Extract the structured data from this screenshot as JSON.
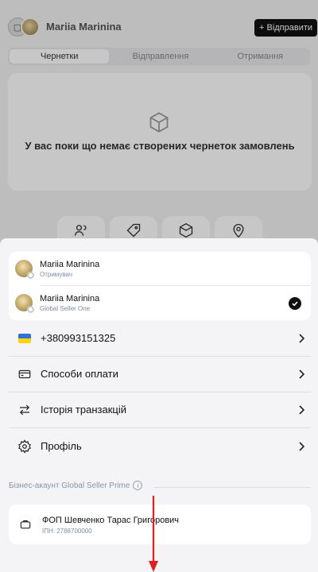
{
  "background": {
    "user_name": "Mariia Marinina",
    "send_button": "+ Відправити",
    "tabs": [
      "Чернетки",
      "Відправлення",
      "Отримання"
    ],
    "empty_text": "У вас поки що немає створених чернеток замовлень"
  },
  "accounts": [
    {
      "name": "Mariia Marinina",
      "role": "Отримувач",
      "selected": false
    },
    {
      "name": "Mariia Marinina",
      "role": "Global Seller One",
      "selected": true
    }
  ],
  "menu": {
    "phone": "+380993151325",
    "payment_methods": "Способи оплати",
    "transactions": "Історія транзакцій",
    "profile": "Профіль"
  },
  "business": {
    "section_title": "Бізнес-акаунт Global Seller Prime",
    "entity_name": "ФОП Шевченко Тарас Григорович",
    "tax_id": "ІПН: 2788700000"
  },
  "colors": {
    "flag_blue": "#2f6fe0",
    "flag_yellow": "#ffd500",
    "arrow": "#e02020"
  }
}
